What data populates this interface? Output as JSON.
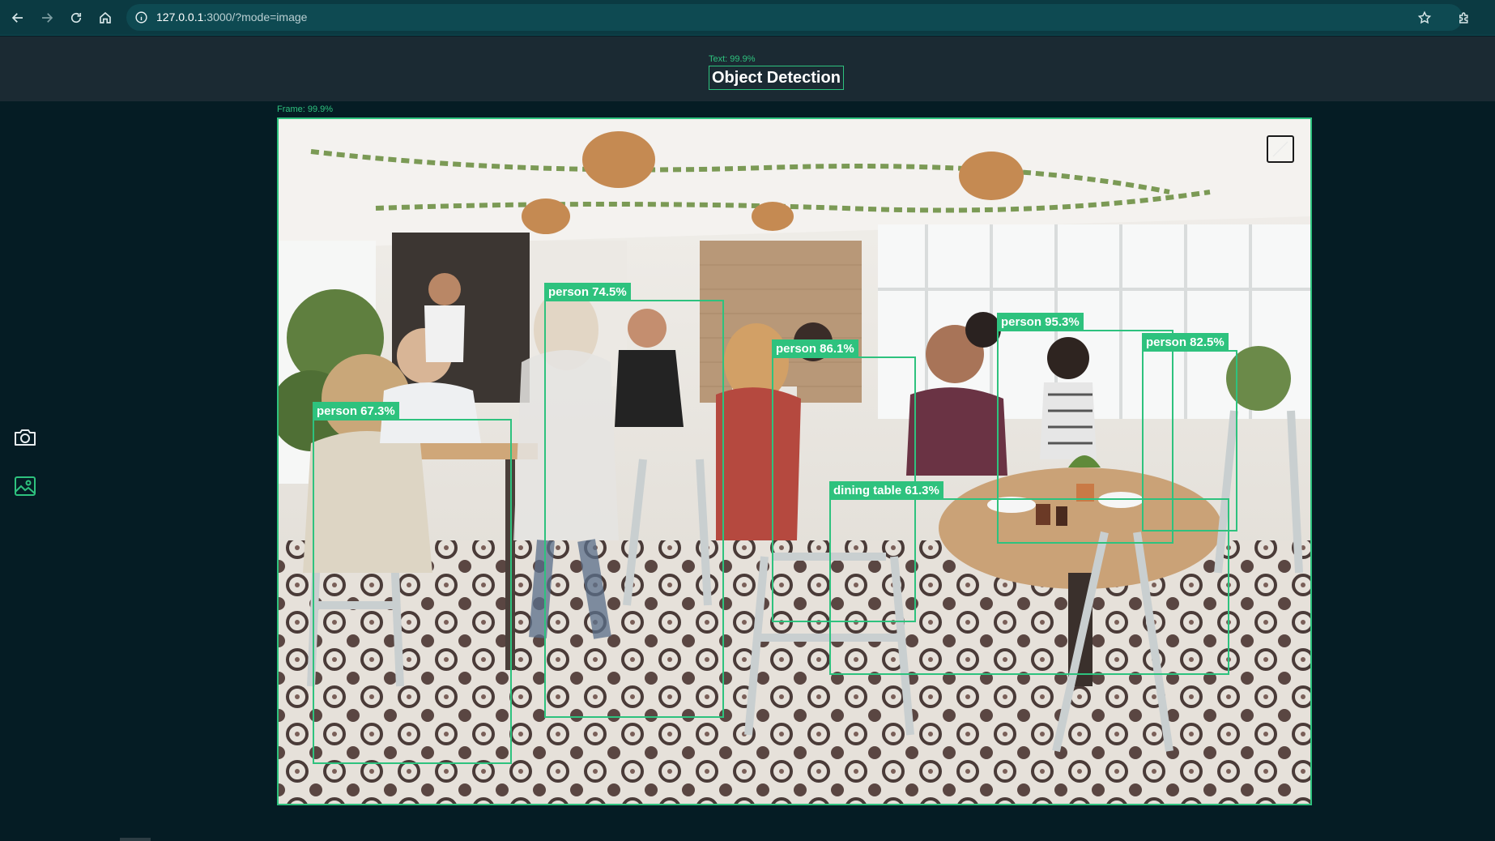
{
  "browser": {
    "url_host": "127.0.0.1",
    "url_rest": ":3000/?mode=image",
    "icons": [
      "back-icon",
      "forward-icon",
      "reload-icon",
      "home-icon",
      "info-icon",
      "star-icon",
      "extensions-icon"
    ]
  },
  "header": {
    "title_tag": "Text: 99.9%",
    "title": "Object Detection"
  },
  "sidebar": {
    "items": [
      {
        "name": "camera-icon",
        "mode": "camera"
      },
      {
        "name": "image-icon",
        "mode": "image",
        "active": true
      }
    ]
  },
  "frame": {
    "tag": "Frame: 99.9%"
  },
  "detections": [
    {
      "label": "person 67.3%"
    },
    {
      "label": "person 74.5%"
    },
    {
      "label": "person 86.1%"
    },
    {
      "label": "person 95.3%"
    },
    {
      "label": "person 82.5%"
    },
    {
      "label": "dining table 61.3%"
    }
  ],
  "colors": {
    "accent": "#2ec27e",
    "background": "#051c24",
    "header": "#1b2a33",
    "browser_bar": "#0b3a42"
  }
}
